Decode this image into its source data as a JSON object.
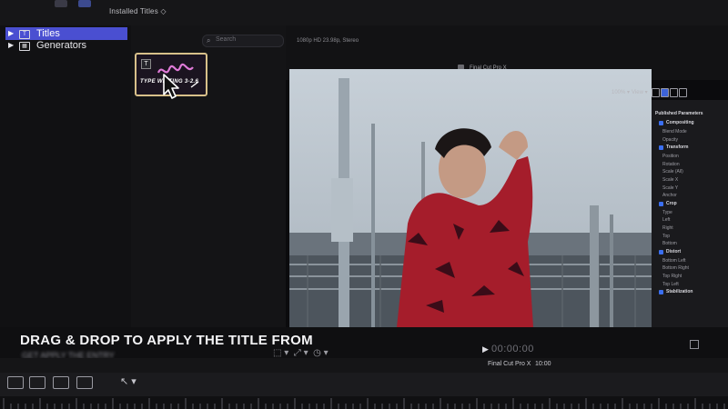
{
  "browser": {
    "title": "Installed Titles ◇",
    "search_placeholder": "Search"
  },
  "sidebar": {
    "items": [
      {
        "arrow": "▶",
        "icon": "T",
        "label": "Titles",
        "selected": true
      },
      {
        "arrow": "▶",
        "icon": "▦",
        "label": "Generators",
        "selected": false
      }
    ]
  },
  "clip": {
    "badge": "T",
    "label": "TYPE WRITING 3-2.6"
  },
  "viewer": {
    "format": "1080p HD 23.98p, Stereo",
    "project_title": "Final Cut Pro X",
    "zoom": "100% ▾",
    "view": "View ▾"
  },
  "inspector": {
    "title": "Published Parameters",
    "rows": [
      {
        "kind": "head",
        "text": "Compositing"
      },
      {
        "kind": "row",
        "text": "Blend Mode"
      },
      {
        "kind": "row",
        "text": "Opacity"
      },
      {
        "kind": "head",
        "text": "Transform"
      },
      {
        "kind": "row",
        "text": "Position"
      },
      {
        "kind": "row",
        "text": "Rotation"
      },
      {
        "kind": "row",
        "text": "Scale (All)"
      },
      {
        "kind": "row",
        "text": "Scale X"
      },
      {
        "kind": "row",
        "text": "Scale Y"
      },
      {
        "kind": "row",
        "text": "Anchor"
      },
      {
        "kind": "head",
        "text": "Crop"
      },
      {
        "kind": "row",
        "text": "Type"
      },
      {
        "kind": "row",
        "text": "Left"
      },
      {
        "kind": "row",
        "text": "Right"
      },
      {
        "kind": "row",
        "text": "Top"
      },
      {
        "kind": "row",
        "text": "Bottom"
      },
      {
        "kind": "head",
        "text": "Distort"
      },
      {
        "kind": "row",
        "text": "Bottom Left"
      },
      {
        "kind": "row",
        "text": "Bottom Right"
      },
      {
        "kind": "row",
        "text": "Top Right"
      },
      {
        "kind": "row",
        "text": "Top Left"
      },
      {
        "kind": "head",
        "text": "Stabilization"
      }
    ]
  },
  "overlay": {
    "headline": "DRAG & DROP TO APPLY THE TITLE FROM",
    "subline": "GET APPLY THE ENTRY"
  },
  "transport": {
    "timecode": "00:00:00",
    "play_symbol": "▶"
  },
  "timeline": {
    "name": "Final Cut Pro X",
    "duration": "10:00"
  }
}
